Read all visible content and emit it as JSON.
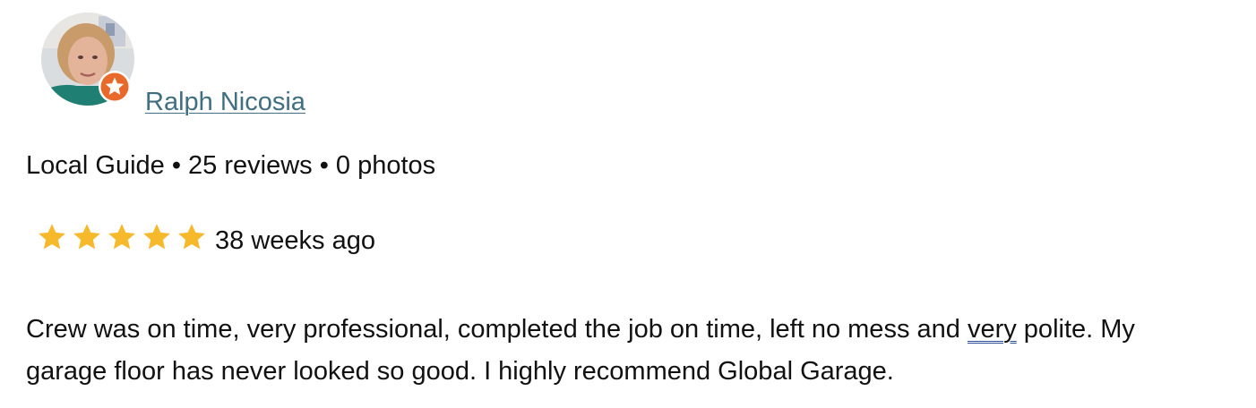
{
  "reviewer": {
    "name": "Ralph Nicosia",
    "badge_icon": "local-guide-star-icon",
    "badge_color": "#e8692a"
  },
  "meta": {
    "line": "Local Guide • 25 reviews • 0 photos"
  },
  "rating": {
    "stars": 5,
    "star_color": "#f6b92b",
    "time": "38 weeks ago"
  },
  "review": {
    "text_part1": "Crew was on time, very professional, completed the job on time, left no mess and ",
    "text_flagged": "very",
    "text_part2": " polite. My garage floor has never looked so good. I highly recommend Global Garage."
  },
  "colors": {
    "name_link": "#3f6f80",
    "text": "#111111"
  }
}
